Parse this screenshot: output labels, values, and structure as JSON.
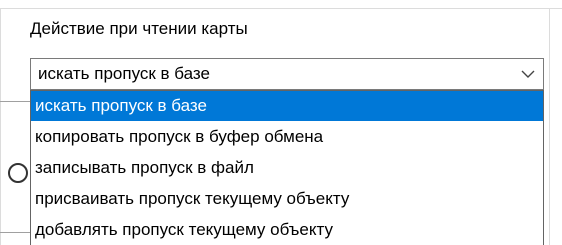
{
  "group": {
    "label": "Действие при чтении карты"
  },
  "combo": {
    "value": "искать пропуск в базе",
    "arrow_icon": "chevron-down-icon"
  },
  "dropdown": {
    "selected_index": 0,
    "selection_color": "#0078d7",
    "options": [
      {
        "label": "искать пропуск в базе"
      },
      {
        "label": "копировать пропуск в буфер обмена"
      },
      {
        "label": "записывать пропуск в файл"
      },
      {
        "label": "присваивать пропуск текущему объекту"
      },
      {
        "label": "добавлять пропуск текущему объекту"
      }
    ]
  }
}
